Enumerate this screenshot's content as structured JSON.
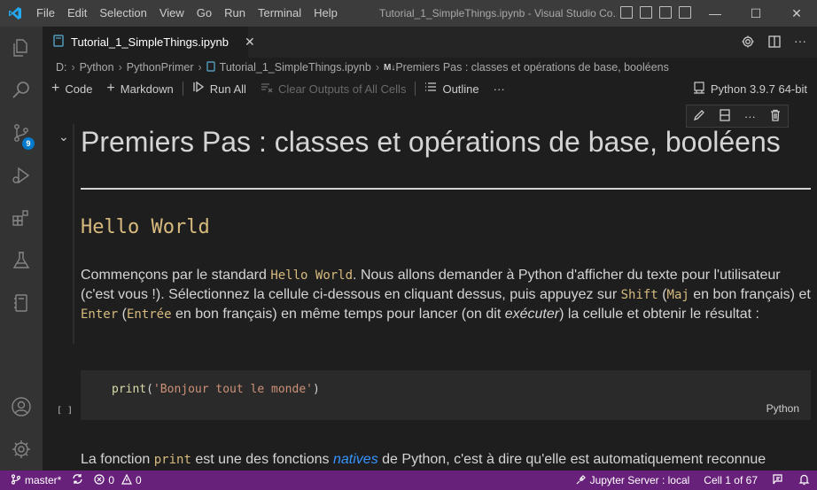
{
  "menu": [
    "File",
    "Edit",
    "Selection",
    "View",
    "Go",
    "Run",
    "Terminal",
    "Help"
  ],
  "window_title": "Tutorial_1_SimpleThings.ipynb - Visual Studio Co...",
  "window_controls": {
    "minimize": "—",
    "maximize": "☐",
    "close": "✕"
  },
  "activity_badge": "9",
  "tab": {
    "label": "Tutorial_1_SimpleThings.ipynb",
    "close": "✕"
  },
  "breadcrumb": {
    "drive": "D:",
    "folder1": "Python",
    "folder2": "PythonPrimer",
    "file": "Tutorial_1_SimpleThings.ipynb",
    "md_marker": "M↓",
    "section": "Premiers Pas : classes et opérations de base, booléens"
  },
  "toolbar": {
    "code": "Code",
    "markdown": "Markdown",
    "run_all": "Run All",
    "clear_outputs": "Clear Outputs of All Cells",
    "outline": "Outline",
    "more": "···",
    "kernel": "Python 3.9.7 64-bit"
  },
  "notebook": {
    "heading": "Premiers Pas : classes et opérations de base, booléens",
    "subheading": "Hello World",
    "para1": {
      "t1": "Commençons par le standard ",
      "c1": "Hello World",
      "t2": ". Nous allons demander à Python d'afficher du texte pour l'utilisateur (c'est vous !). Sélectionnez la cellule ci-dessous en cliquant dessus, puis appuyez sur ",
      "c2": "Shift",
      "t3": " (",
      "c3": "Maj",
      "t4": " en bon français) et ",
      "c4": "Enter",
      "t5": " (",
      "c5": "Entrée",
      "t6": " en bon français) en même temps pour lancer (on dit ",
      "em": "exécuter",
      "t7": ") la cellule et obtenir le résultat :"
    },
    "code": {
      "func": "print",
      "open": "(",
      "string": "'Bonjour tout le monde'",
      "close": ")"
    },
    "exec_count": "[ ]",
    "language": "Python",
    "para2": {
      "t1": "La fonction ",
      "c1": "print",
      "t2": " est une des fonctions ",
      "link": "natives",
      "t3": " de Python, c'est à dire qu'elle est automatiquement reconnue"
    }
  },
  "statusbar": {
    "branch": "master*",
    "errors": "0",
    "warnings": "0",
    "jupyter": "Jupyter Server : local",
    "cell": "Cell 1 of 67"
  },
  "colors": {
    "titlebar": "#3c3c3c",
    "activitybar": "#333333",
    "editor": "#1e1e1e",
    "statusbar": "#68217a",
    "vscode_blue": "#23a9f2",
    "heading_gold": "#d7ba7d",
    "link": "#3794ff"
  }
}
